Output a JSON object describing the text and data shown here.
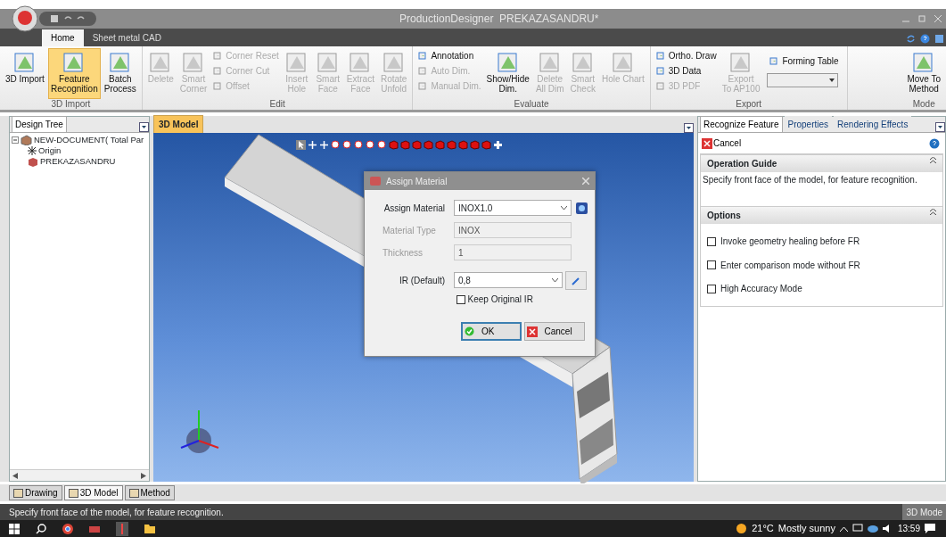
{
  "window": {
    "title": "ProductionDesigner  PREKAZASANDRU*"
  },
  "ribbon_tabs": [
    {
      "label": "Home",
      "selected": true
    },
    {
      "label": "Sheet metal CAD",
      "selected": false
    }
  ],
  "ribbon_groups": [
    {
      "label": "3D Import",
      "items": [
        {
          "kind": "large",
          "label": "3D Import",
          "selected": false,
          "disabled": false
        },
        {
          "kind": "large",
          "label": "Feature\nRecognition",
          "selected": true,
          "disabled": false
        },
        {
          "kind": "large",
          "label": "Batch\nProcess",
          "selected": false,
          "disabled": false
        }
      ]
    },
    {
      "label": "Edit",
      "items": [
        {
          "kind": "large",
          "label": "Delete",
          "selected": false,
          "disabled": true
        },
        {
          "kind": "large",
          "label": "Smart\nCorner",
          "selected": false,
          "disabled": true
        },
        {
          "kind": "stack",
          "items": [
            {
              "label": "Corner Reset",
              "disabled": true
            },
            {
              "label": "Corner Cut",
              "disabled": true
            },
            {
              "label": "Offset",
              "disabled": true
            }
          ]
        },
        {
          "kind": "large",
          "label": "Insert\nHole",
          "selected": false,
          "disabled": true
        },
        {
          "kind": "large",
          "label": "Smart\nFace",
          "selected": false,
          "disabled": true
        },
        {
          "kind": "large",
          "label": "Extract\nFace",
          "selected": false,
          "disabled": true
        },
        {
          "kind": "large",
          "label": "Rotate\nUnfold",
          "selected": false,
          "disabled": true
        }
      ]
    },
    {
      "label": "Evaluate",
      "items": [
        {
          "kind": "stack",
          "items": [
            {
              "label": "Annotation",
              "disabled": false
            },
            {
              "label": "Auto Dim.",
              "disabled": true
            },
            {
              "label": "Manual Dim.",
              "disabled": true
            }
          ]
        },
        {
          "kind": "large",
          "label": "Show/Hide\nDim.",
          "selected": false,
          "disabled": false
        },
        {
          "kind": "large",
          "label": "Delete\nAll Dim",
          "selected": false,
          "disabled": true
        },
        {
          "kind": "large",
          "label": "Smart\nCheck",
          "selected": false,
          "disabled": true
        },
        {
          "kind": "large",
          "label": "Hole Chart",
          "selected": false,
          "disabled": true
        }
      ]
    },
    {
      "label": "Export",
      "items": [
        {
          "kind": "stack",
          "items": [
            {
              "label": "Ortho. Draw",
              "disabled": false
            },
            {
              "label": "3D Data",
              "disabled": false
            },
            {
              "label": "3D PDF",
              "disabled": true
            }
          ]
        },
        {
          "kind": "large",
          "label": "Export\nTo AP100",
          "selected": false,
          "disabled": true
        },
        {
          "kind": "combo",
          "label": "Forming Table"
        }
      ]
    },
    {
      "label": "Mode",
      "items": [
        {
          "kind": "large",
          "label": "Move To\nMethod",
          "selected": false,
          "disabled": false
        }
      ]
    }
  ],
  "design_tree": {
    "tab": "Design Tree",
    "nodes": [
      {
        "label": "NEW-DOCUMENT(  Total Par",
        "expanded": true,
        "children": [
          {
            "label": "Origin"
          },
          {
            "label": "PREKAZASANDRU"
          }
        ]
      }
    ]
  },
  "view_tab": "3D Model",
  "dialog": {
    "title": "Assign Material",
    "fields": [
      {
        "label": "Assign Material",
        "value": "INOX1.0",
        "disabled": false,
        "kind": "select"
      },
      {
        "label": "Material Type",
        "value": "INOX",
        "disabled": true,
        "kind": "text"
      },
      {
        "label": "Thickness",
        "value": "1",
        "disabled": true,
        "kind": "text"
      },
      {
        "label": "IR (Default)",
        "value": "0,8",
        "disabled": false,
        "kind": "combo"
      }
    ],
    "keep_original_ir": {
      "label": "Keep Original IR",
      "checked": false
    },
    "ok": "OK",
    "cancel": "Cancel"
  },
  "right_panel": {
    "tabs": [
      {
        "label": "Recognize Feature",
        "selected": true
      },
      {
        "label": "Properties",
        "selected": false
      },
      {
        "label": "Rendering Effects",
        "selected": false
      }
    ],
    "cancel": "Cancel",
    "operation_guide": {
      "title": "Operation Guide",
      "text": "Specify front face of the model, for feature recognition."
    },
    "options": {
      "title": "Options",
      "items": [
        {
          "label": "Invoke geometry healing before FR",
          "checked": false
        },
        {
          "label": "Enter comparison mode without FR",
          "checked": false
        },
        {
          "label": "High Accuracy Mode",
          "checked": false
        }
      ]
    }
  },
  "bottom_tabs": [
    {
      "label": "Drawing",
      "selected": false
    },
    {
      "label": "3D Model",
      "selected": true
    },
    {
      "label": "Method",
      "selected": false
    }
  ],
  "status_bar": {
    "text": "Specify front face of the model, for feature recognition.",
    "mode": "3D Mode"
  },
  "taskbar": {
    "weather_temp": "21°C",
    "weather_text": "Mostly sunny",
    "time": "13:59"
  }
}
